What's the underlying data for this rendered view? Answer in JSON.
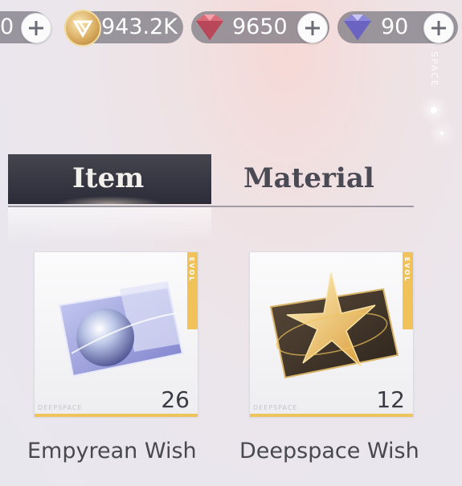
{
  "currency": {
    "partial_value": "0",
    "gold": "943.2K",
    "red_gems": "9650",
    "purple_gems": "90"
  },
  "edge_text": "SPACE",
  "tabs": {
    "item": "Item",
    "material": "Material"
  },
  "items": [
    {
      "name": "Empyrean Wish",
      "count": "26",
      "brand": "DEEPSPACE",
      "badge": "EVOL"
    },
    {
      "name": "Deepspace Wish",
      "count": "12",
      "brand": "DEEPSPACE",
      "badge": "EVOL"
    }
  ],
  "colors": {
    "tab_active_bg": "#2b2c38",
    "accent_gold": "#f0c45c",
    "text_dark": "#48484f"
  }
}
